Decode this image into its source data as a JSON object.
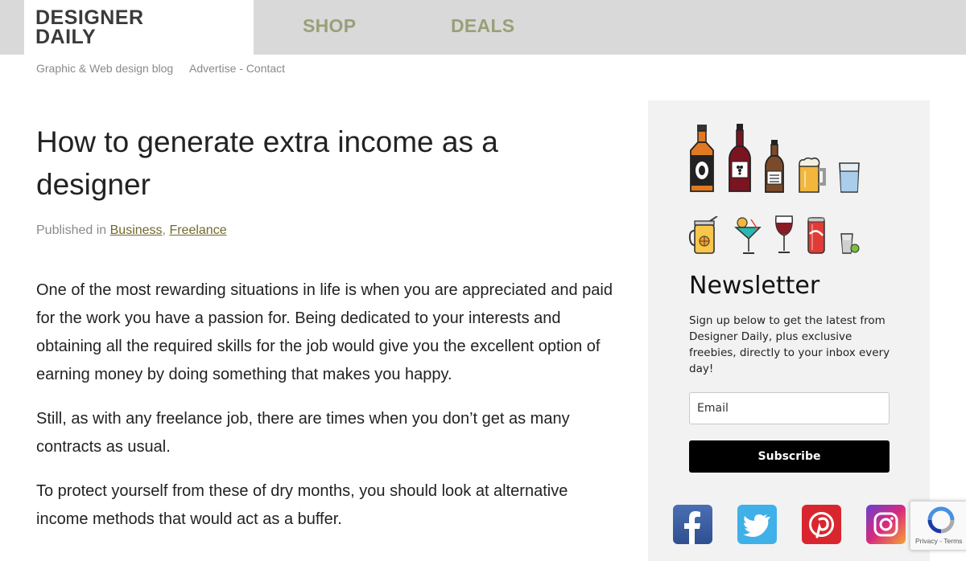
{
  "header": {
    "logo_line1": "DESIGNER",
    "logo_line2": "DAILY",
    "nav": [
      "SHOP",
      "DEALS"
    ],
    "tagline": "Graphic & Web design blog",
    "advertise": "Advertise",
    "link_separator": " - ",
    "contact": "Contact"
  },
  "article": {
    "title": "How to generate extra income as a designer",
    "published_prefix": "Published in ",
    "categories": [
      "Business",
      "Freelance"
    ],
    "category_separator": ", ",
    "paragraphs": [
      "One of the most rewarding situations in life is when you are appreciated and paid for the work you have a passion for. Being dedicated to your interests and obtaining all the required skills for the job would give you the excellent option of earning money by doing something that makes you happy.",
      "Still, as with any freelance job, there are times when you don’t get as many contracts as usual.",
      "To protect yourself from these of dry months, you should look at alternative income methods that would act as a buffer."
    ]
  },
  "sidebar": {
    "drink_icons": [
      "whiskey-bottle-icon",
      "wine-bottle-icon",
      "beer-bottle-icon",
      "beer-mug-icon",
      "water-glass-icon",
      "lemonade-jar-icon",
      "cocktail-glass-icon",
      "wine-glass-icon",
      "soda-can-icon",
      "shot-glass-icon"
    ],
    "newsletter_title": "Newsletter",
    "newsletter_desc": "Sign up below to get the latest from Designer Daily, plus exclusive freebies, directly to your inbox every day!",
    "email_placeholder": "Email",
    "subscribe_label": "Subscribe",
    "social": [
      "facebook-icon",
      "twitter-icon",
      "pinterest-icon",
      "instagram-icon"
    ]
  },
  "recaptcha": {
    "privacy": "Privacy",
    "separator": " - ",
    "terms": "Terms"
  },
  "colors": {
    "nav_text": "#9a9f78",
    "link": "#6f6a2e",
    "header_bg": "#d9d9d9",
    "sidebar_bg": "#f2f2f2"
  }
}
